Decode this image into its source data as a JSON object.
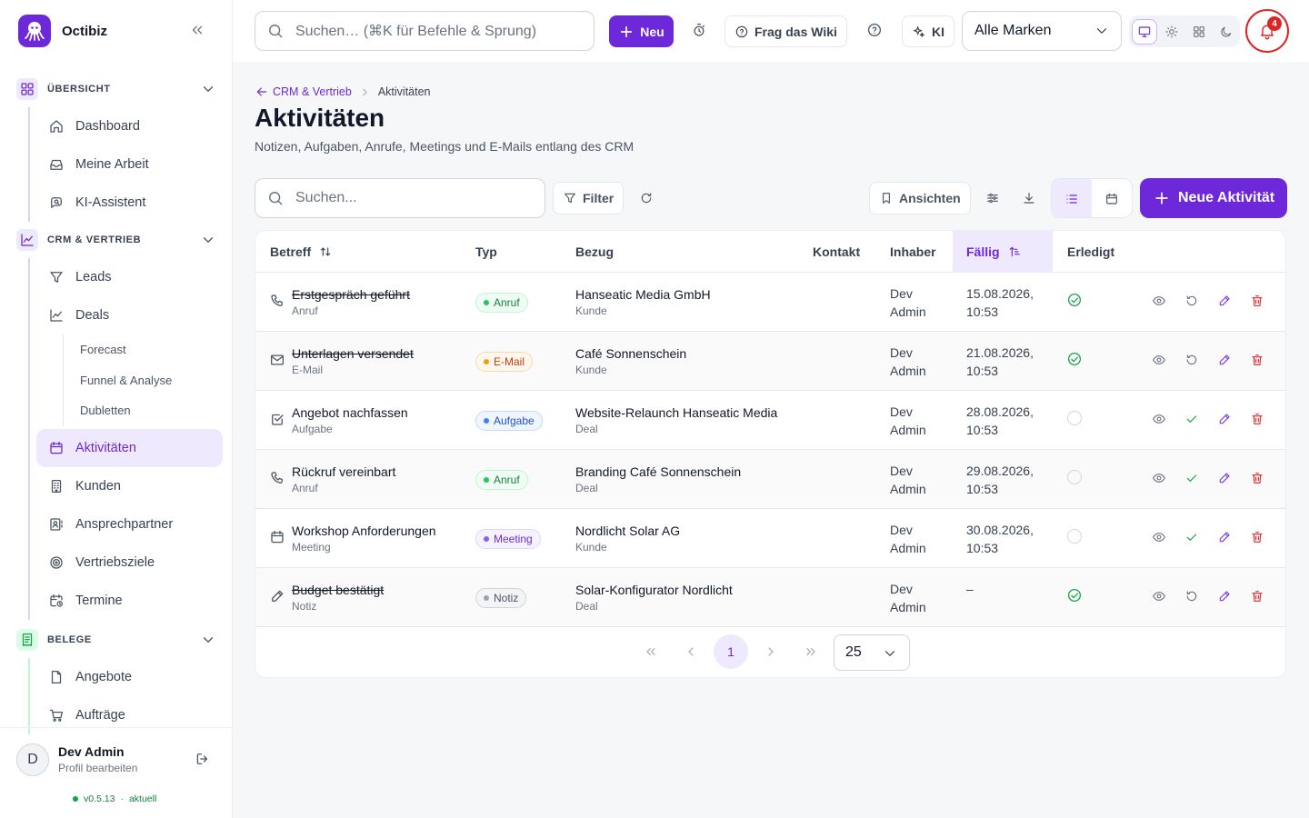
{
  "app": {
    "name": "Octibiz",
    "version": "v0.5.13",
    "version_status": "aktuell"
  },
  "topbar": {
    "search_placeholder": "Suchen… (⌘K für Befehle & Sprung)",
    "new_label": "Neu",
    "wiki_label": "Frag das Wiki",
    "ai_label": "KI",
    "brand_select": "Alle Marken",
    "notification_count": "4"
  },
  "sidebar": {
    "groups": [
      {
        "label": "ÜBERSICHT",
        "items": [
          "Dashboard",
          "Meine Arbeit",
          "KI-Assistent"
        ]
      },
      {
        "label": "CRM & VERTRIEB",
        "items": [
          "Leads",
          "Deals",
          "Aktivitäten",
          "Kunden",
          "Ansprechpartner",
          "Vertriebsziele",
          "Termine"
        ],
        "deals_sub": [
          "Forecast",
          "Funnel & Analyse",
          "Dubletten"
        ]
      },
      {
        "label": "BELEGE",
        "items": [
          "Angebote",
          "Aufträge"
        ]
      }
    ],
    "active_item": "Aktivitäten"
  },
  "profile": {
    "initial": "D",
    "name": "Dev Admin",
    "subtitle": "Profil bearbeiten"
  },
  "page": {
    "breadcrumb_parent": "CRM & Vertrieb",
    "breadcrumb_current": "Aktivitäten",
    "title": "Aktivitäten",
    "subtitle": "Notizen, Aufgaben, Anrufe, Meetings und E-Mails entlang des CRM",
    "search_placeholder": "Suchen...",
    "filter_label": "Filter",
    "views_label": "Ansichten",
    "new_activity_label": "Neue Aktivität"
  },
  "table": {
    "headers": {
      "subject": "Betreff",
      "type": "Typ",
      "reference": "Bezug",
      "contact": "Kontakt",
      "owner": "Inhaber",
      "due": "Fällig",
      "done": "Erledigt"
    },
    "rows": [
      {
        "title": "Erstgespräch geführt",
        "type_sub": "Anruf",
        "badge": "Anruf",
        "ref": "Hanseatic Media GmbH",
        "ref_sub": "Kunde",
        "owner_1": "Dev",
        "owner_2": "Admin",
        "due_1": "15.08.2026,",
        "due_2": "10:53",
        "done": true,
        "icon": "phone-icon"
      },
      {
        "title": "Unterlagen versendet",
        "type_sub": "E-Mail",
        "badge": "E-Mail",
        "ref": "Café Sonnenschein",
        "ref_sub": "Kunde",
        "owner_1": "Dev",
        "owner_2": "Admin",
        "due_1": "21.08.2026,",
        "due_2": "10:53",
        "done": true,
        "icon": "mail-icon"
      },
      {
        "title": "Angebot nachfassen",
        "type_sub": "Aufgabe",
        "badge": "Aufgabe",
        "ref": "Website-Relaunch Hanseatic Media",
        "ref_sub": "Deal",
        "owner_1": "Dev",
        "owner_2": "Admin",
        "due_1": "28.08.2026,",
        "due_2": "10:53",
        "done": false,
        "icon": "checkbox-icon"
      },
      {
        "title": "Rückruf vereinbart",
        "type_sub": "Anruf",
        "badge": "Anruf",
        "ref": "Branding Café Sonnenschein",
        "ref_sub": "Deal",
        "owner_1": "Dev",
        "owner_2": "Admin",
        "due_1": "29.08.2026,",
        "due_2": "10:53",
        "done": false,
        "icon": "phone-icon"
      },
      {
        "title": "Workshop Anforderungen",
        "type_sub": "Meeting",
        "badge": "Meeting",
        "ref": "Nordlicht Solar AG",
        "ref_sub": "Kunde",
        "owner_1": "Dev",
        "owner_2": "Admin",
        "due_1": "30.08.2026,",
        "due_2": "10:53",
        "done": false,
        "icon": "calendar-icon"
      },
      {
        "title": "Budget bestätigt",
        "type_sub": "Notiz",
        "badge": "Notiz",
        "ref": "Solar-Konfigurator Nordlicht",
        "ref_sub": "Deal",
        "owner_1": "Dev",
        "owner_2": "Admin",
        "due_1": "–",
        "due_2": "",
        "done": true,
        "icon": "pencil-icon"
      }
    ]
  },
  "pagination": {
    "current_page": "1",
    "page_size": "25"
  },
  "colors": {
    "accent": "#6d28d9",
    "accent_light": "#efe9fd",
    "success": "#16a34a",
    "danger": "#dc2626"
  }
}
